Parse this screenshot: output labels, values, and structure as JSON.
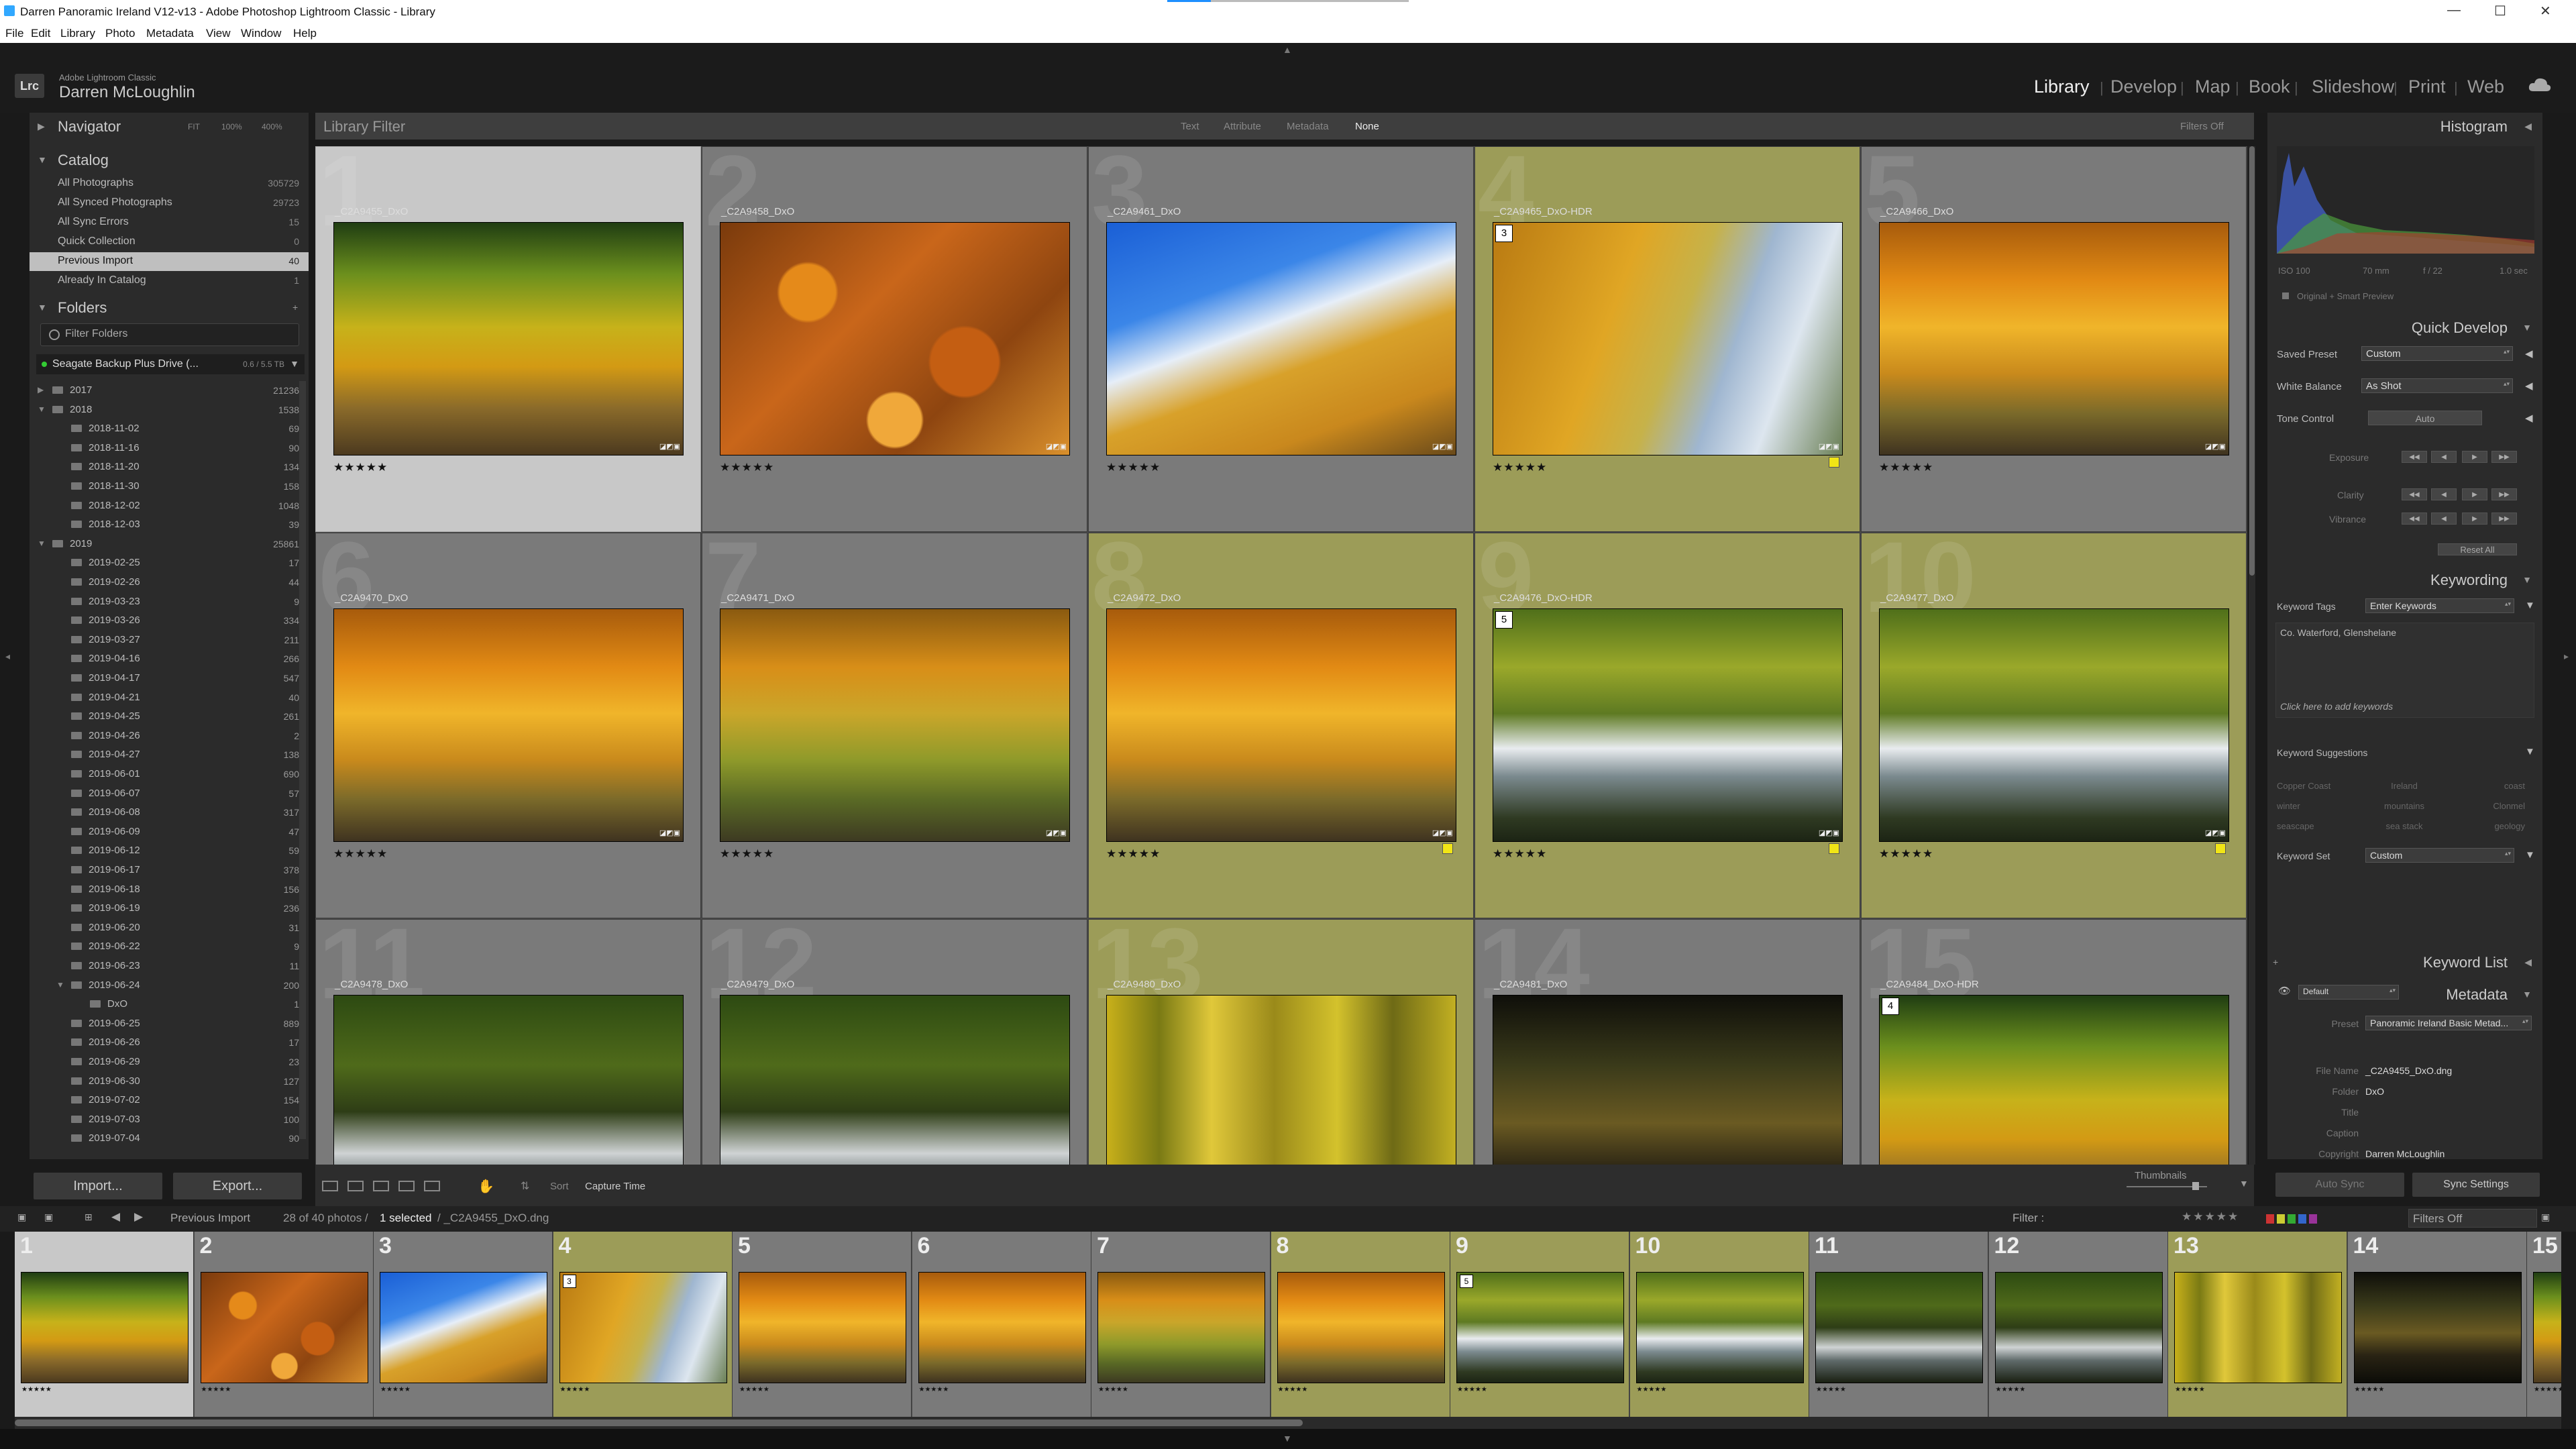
{
  "window": {
    "title": "Darren Panoramic Ireland V12-v13 - Adobe Photoshop Lightroom Classic - Library",
    "controls": {
      "minimize": "—",
      "maximize": "☐",
      "close": "✕"
    }
  },
  "menu": [
    "File",
    "Edit",
    "Library",
    "Photo",
    "Metadata",
    "View",
    "Window",
    "Help"
  ],
  "identity": {
    "logo": "Lrc",
    "app": "Adobe Lightroom Classic",
    "user": "Darren McLoughlin"
  },
  "modules": [
    "Library",
    "Develop",
    "Map",
    "Book",
    "Slideshow",
    "Print",
    "Web"
  ],
  "active_module": "Library",
  "navigator": {
    "title": "Navigator",
    "zoom": [
      "FIT",
      "100%",
      "400%"
    ]
  },
  "catalog": {
    "title": "Catalog",
    "items": [
      {
        "name": "All Photographs",
        "count": "305729"
      },
      {
        "name": "All Synced Photographs",
        "count": "29723"
      },
      {
        "name": "All Sync Errors",
        "count": "15"
      },
      {
        "name": "Quick Collection",
        "count": "0"
      },
      {
        "name": "Previous Import",
        "count": "40"
      },
      {
        "name": "Already In Catalog",
        "count": "1"
      }
    ]
  },
  "folders": {
    "title": "Folders",
    "filter": "Filter Folders",
    "volume": {
      "name": "Seagate Backup Plus Drive (...",
      "size": "0.6 / 5.5 TB"
    },
    "items": [
      {
        "name": "2017",
        "count": "21236",
        "level": 0
      },
      {
        "name": "2018",
        "count": "1538",
        "level": 0
      },
      {
        "name": "2018-11-02",
        "count": "69",
        "level": 1
      },
      {
        "name": "2018-11-16",
        "count": "90",
        "level": 1
      },
      {
        "name": "2018-11-20",
        "count": "134",
        "level": 1
      },
      {
        "name": "2018-11-30",
        "count": "158",
        "level": 1
      },
      {
        "name": "2018-12-02",
        "count": "1048",
        "level": 1
      },
      {
        "name": "2018-12-03",
        "count": "39",
        "level": 1
      },
      {
        "name": "2019",
        "count": "25861",
        "level": 0
      },
      {
        "name": "2019-02-25",
        "count": "17",
        "level": 1
      },
      {
        "name": "2019-02-26",
        "count": "44",
        "level": 1
      },
      {
        "name": "2019-03-23",
        "count": "9",
        "level": 1
      },
      {
        "name": "2019-03-26",
        "count": "334",
        "level": 1
      },
      {
        "name": "2019-03-27",
        "count": "211",
        "level": 1
      },
      {
        "name": "2019-04-16",
        "count": "266",
        "level": 1
      },
      {
        "name": "2019-04-17",
        "count": "547",
        "level": 1
      },
      {
        "name": "2019-04-21",
        "count": "40",
        "level": 1
      },
      {
        "name": "2019-04-25",
        "count": "261",
        "level": 1
      },
      {
        "name": "2019-04-26",
        "count": "2",
        "level": 1
      },
      {
        "name": "2019-04-27",
        "count": "138",
        "level": 1
      },
      {
        "name": "2019-06-01",
        "count": "690",
        "level": 1
      },
      {
        "name": "2019-06-07",
        "count": "57",
        "level": 1
      },
      {
        "name": "2019-06-08",
        "count": "317",
        "level": 1
      },
      {
        "name": "2019-06-09",
        "count": "47",
        "level": 1
      },
      {
        "name": "2019-06-12",
        "count": "59",
        "level": 1
      },
      {
        "name": "2019-06-17",
        "count": "378",
        "level": 1
      },
      {
        "name": "2019-06-18",
        "count": "156",
        "level": 1
      },
      {
        "name": "2019-06-19",
        "count": "236",
        "level": 1
      },
      {
        "name": "2019-06-20",
        "count": "31",
        "level": 1
      },
      {
        "name": "2019-06-22",
        "count": "9",
        "level": 1
      },
      {
        "name": "2019-06-23",
        "count": "11",
        "level": 1
      },
      {
        "name": "2019-06-24",
        "count": "200",
        "level": 1
      },
      {
        "name": "DxO",
        "count": "1",
        "level": 2
      },
      {
        "name": "2019-06-25",
        "count": "889",
        "level": 1
      },
      {
        "name": "2019-06-26",
        "count": "17",
        "level": 1
      },
      {
        "name": "2019-06-29",
        "count": "23",
        "level": 1
      },
      {
        "name": "2019-06-30",
        "count": "127",
        "level": 1
      },
      {
        "name": "2019-07-02",
        "count": "154",
        "level": 1
      },
      {
        "name": "2019-07-03",
        "count": "100",
        "level": 1
      },
      {
        "name": "2019-07-04",
        "count": "90",
        "level": 1
      }
    ]
  },
  "left_buttons": {
    "import": "Import...",
    "export": "Export..."
  },
  "library_filter": {
    "title": "Library Filter",
    "options": [
      "Text",
      "Attribute",
      "Metadata",
      "None"
    ],
    "active": "None",
    "filters_off": "Filters Off"
  },
  "photos": [
    {
      "num": "1",
      "name": "_C2A9455_DxO",
      "stars": "★★★★★",
      "bg": "selected",
      "badge": "",
      "label": false,
      "scene": "forest-path"
    },
    {
      "num": "2",
      "name": "_C2A9458_DxO",
      "stars": "★★★★★",
      "bg": "gray",
      "badge": "",
      "label": false,
      "scene": "leaves"
    },
    {
      "num": "3",
      "name": "_C2A9461_DxO",
      "stars": "★★★★★",
      "bg": "gray",
      "badge": "",
      "label": false,
      "scene": "sky-trees"
    },
    {
      "num": "4",
      "name": "_C2A9465_DxO-HDR",
      "stars": "★★★★★",
      "bg": "olive",
      "badge": "3",
      "label": true,
      "scene": "autumn-cloud"
    },
    {
      "num": "5",
      "name": "_C2A9466_DxO",
      "stars": "★★★★★",
      "bg": "gray",
      "badge": "",
      "label": false,
      "scene": "autumn"
    },
    {
      "num": "6",
      "name": "_C2A9470_DxO",
      "stars": "★★★★★",
      "bg": "gray",
      "badge": "",
      "label": false,
      "scene": "autumn"
    },
    {
      "num": "7",
      "name": "_C2A9471_DxO",
      "stars": "★★★★★",
      "bg": "gray",
      "badge": "",
      "label": false,
      "scene": "autumn-green"
    },
    {
      "num": "8",
      "name": "_C2A9472_DxO",
      "stars": "★★★★★",
      "bg": "olive",
      "badge": "",
      "label": true,
      "scene": "autumn"
    },
    {
      "num": "9",
      "name": "_C2A9476_DxO-HDR",
      "stars": "★★★★★",
      "bg": "olive",
      "badge": "5",
      "label": true,
      "scene": "river"
    },
    {
      "num": "10",
      "name": "_C2A9477_DxO",
      "stars": "★★★★★",
      "bg": "olive",
      "badge": "",
      "label": true,
      "scene": "river"
    },
    {
      "num": "11",
      "name": "_C2A9478_DxO",
      "stars": "",
      "bg": "gray",
      "badge": "",
      "label": false,
      "scene": "river-dark"
    },
    {
      "num": "12",
      "name": "_C2A9479_DxO",
      "stars": "",
      "bg": "gray",
      "badge": "",
      "label": false,
      "scene": "river-dark"
    },
    {
      "num": "13",
      "name": "_C2A9480_DxO",
      "stars": "",
      "bg": "olive",
      "badge": "",
      "label": false,
      "scene": "yellow-forest"
    },
    {
      "num": "14",
      "name": "_C2A9481_DxO",
      "stars": "",
      "bg": "gray",
      "badge": "",
      "label": false,
      "scene": "dark-forest"
    },
    {
      "num": "15",
      "name": "_C2A9484_DxO-HDR",
      "stars": "",
      "bg": "gray",
      "badge": "4",
      "label": false,
      "scene": "forest-path"
    }
  ],
  "toolbar": {
    "sort_label": "Sort",
    "sort_value": "Capture Time",
    "thumbnails": "Thumbnails"
  },
  "histogram": {
    "title": "Histogram",
    "iso": "ISO 100",
    "focal": "70 mm",
    "aperture": "f / 22",
    "shutter": "1.0 sec",
    "preview": "Original + Smart Preview"
  },
  "quick_develop": {
    "title": "Quick Develop",
    "saved_preset_label": "Saved Preset",
    "saved_preset": "Custom",
    "wb_label": "White Balance",
    "wb": "As Shot",
    "tone_label": "Tone Control",
    "auto": "Auto",
    "sliders": [
      "Exposure",
      "Clarity",
      "Vibrance"
    ],
    "reset": "Reset All"
  },
  "keywording": {
    "title": "Keywording",
    "tags_label": "Keyword Tags",
    "tags_value": "Enter Keywords",
    "keywords": "Co. Waterford, Glenshelane",
    "add_hint": "Click here to add keywords",
    "suggestions_label": "Keyword Suggestions",
    "suggestions": [
      "Copper Coast",
      "Ireland",
      "coast",
      "winter",
      "mountains",
      "Clonmel",
      "seascape",
      "sea stack",
      "geology"
    ],
    "set_label": "Keyword Set",
    "set_value": "Custom"
  },
  "keyword_list": {
    "title": "Keyword List"
  },
  "metadata": {
    "title": "Metadata",
    "default": "Default",
    "preset_label": "Preset",
    "preset": "Panoramic Ireland Basic Metad...",
    "fields": [
      {
        "label": "File Name",
        "value": "_C2A9455_DxO.dng"
      },
      {
        "label": "Folder",
        "value": "DxO"
      },
      {
        "label": "Title",
        "value": ""
      },
      {
        "label": "Caption",
        "value": ""
      },
      {
        "label": "Copyright",
        "value": "Darren McLoughlin"
      }
    ]
  },
  "sync": {
    "auto_sync": "Auto Sync",
    "sync_settings": "Sync Settings"
  },
  "filmstrip_bar": {
    "source": "Previous Import",
    "count": "28 of 40 photos /",
    "selected": "1 selected",
    "path": "/ _C2A9455_DxO.dng",
    "filter_label": "Filter :",
    "filters_off": "Filters Off"
  },
  "filmstrip": [
    {
      "num": "1",
      "scene": "forest-path",
      "bg": "selected",
      "badge": ""
    },
    {
      "num": "2",
      "scene": "leaves",
      "bg": "gray",
      "badge": ""
    },
    {
      "num": "3",
      "scene": "sky-trees",
      "bg": "gray",
      "badge": ""
    },
    {
      "num": "4",
      "scene": "autumn-cloud",
      "bg": "olive",
      "badge": "3"
    },
    {
      "num": "5",
      "scene": "autumn",
      "bg": "gray",
      "badge": ""
    },
    {
      "num": "6",
      "scene": "autumn",
      "bg": "gray",
      "badge": ""
    },
    {
      "num": "7",
      "scene": "autumn-green",
      "bg": "gray",
      "badge": ""
    },
    {
      "num": "8",
      "scene": "autumn",
      "bg": "olive",
      "badge": ""
    },
    {
      "num": "9",
      "scene": "river",
      "bg": "olive",
      "badge": "5"
    },
    {
      "num": "10",
      "scene": "river",
      "bg": "olive",
      "badge": ""
    },
    {
      "num": "11",
      "scene": "river-dark",
      "bg": "gray",
      "badge": ""
    },
    {
      "num": "12",
      "scene": "river-dark",
      "bg": "gray",
      "badge": ""
    },
    {
      "num": "13",
      "scene": "yellow-forest",
      "bg": "olive",
      "badge": ""
    },
    {
      "num": "14",
      "scene": "dark-forest",
      "bg": "gray",
      "badge": ""
    },
    {
      "num": "15",
      "scene": "forest-path",
      "bg": "gray",
      "badge": ""
    }
  ],
  "colors": {
    "cell_gray": "#7a7a7a",
    "cell_olive": "#9c9c58",
    "cell_selected": "#c8c8c8",
    "color_label": "#f1e516"
  }
}
